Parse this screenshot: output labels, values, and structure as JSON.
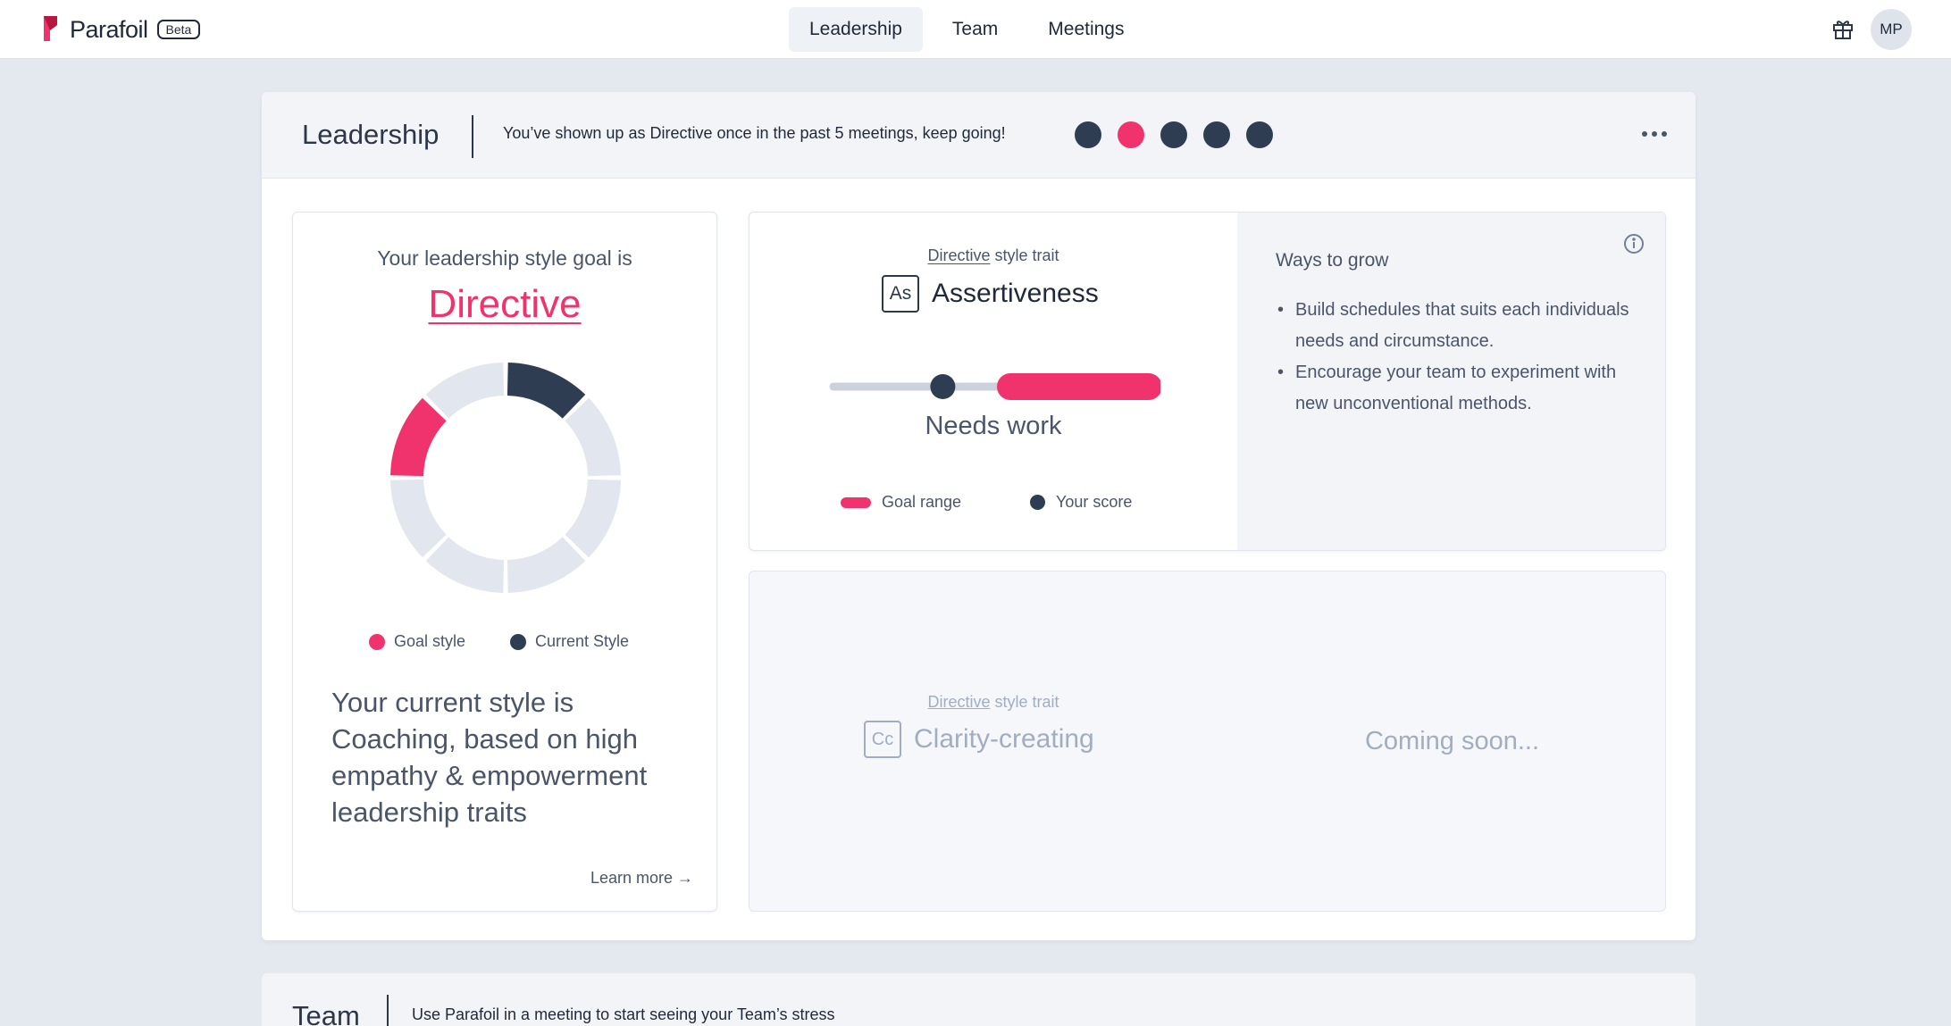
{
  "app": {
    "name": "Parafoil",
    "badge": "Beta"
  },
  "nav": {
    "tabs": [
      {
        "label": "Leadership",
        "active": true
      },
      {
        "label": "Team",
        "active": false
      },
      {
        "label": "Meetings",
        "active": false
      }
    ]
  },
  "user": {
    "initials": "MP"
  },
  "leadership": {
    "title": "Leadership",
    "message": "You’ve shown up as Directive once in the past 5 meetings, keep going!",
    "meeting_dots": [
      "current",
      "goal",
      "current",
      "current",
      "current"
    ],
    "goal_card": {
      "intro": "Your leadership style goal is",
      "goal_style": "Directive",
      "donut_segments": [
        {
          "style": "current"
        },
        {
          "style": "other"
        },
        {
          "style": "other"
        },
        {
          "style": "other"
        },
        {
          "style": "other"
        },
        {
          "style": "other"
        },
        {
          "style": "goal"
        },
        {
          "style": "other"
        }
      ],
      "legend": {
        "goal": "Goal style",
        "current": "Current Style"
      },
      "current_text": "Your current style is Coaching, based on high empathy & empowerment leadership traits",
      "learn_more": "Learn more →"
    },
    "trait": {
      "style_link": "Directive",
      "style_suffix": "style trait",
      "abbr": "As",
      "name": "Assertiveness",
      "score": 0.34,
      "goal_range": [
        0.55,
        0.98
      ],
      "status": "Needs work",
      "legend": {
        "goal": "Goal range",
        "score": "Your score"
      },
      "grow_title": "Ways to grow",
      "grow_items": [
        "Build schedules that suits each individuals needs and circumstance.",
        "Encourage your team to experiment with new unconventional methods."
      ]
    },
    "upcoming_trait": {
      "style_link": "Directive",
      "style_suffix": "style trait",
      "abbr": "Cc",
      "name": "Clarity-creating",
      "status": "Coming soon..."
    }
  },
  "team": {
    "title": "Team",
    "message": "Use Parafoil in a meeting to start seeing your Team’s stress"
  },
  "colors": {
    "goal": "#f0336d",
    "current": "#2f3d52",
    "other": "#e2e6ee"
  }
}
